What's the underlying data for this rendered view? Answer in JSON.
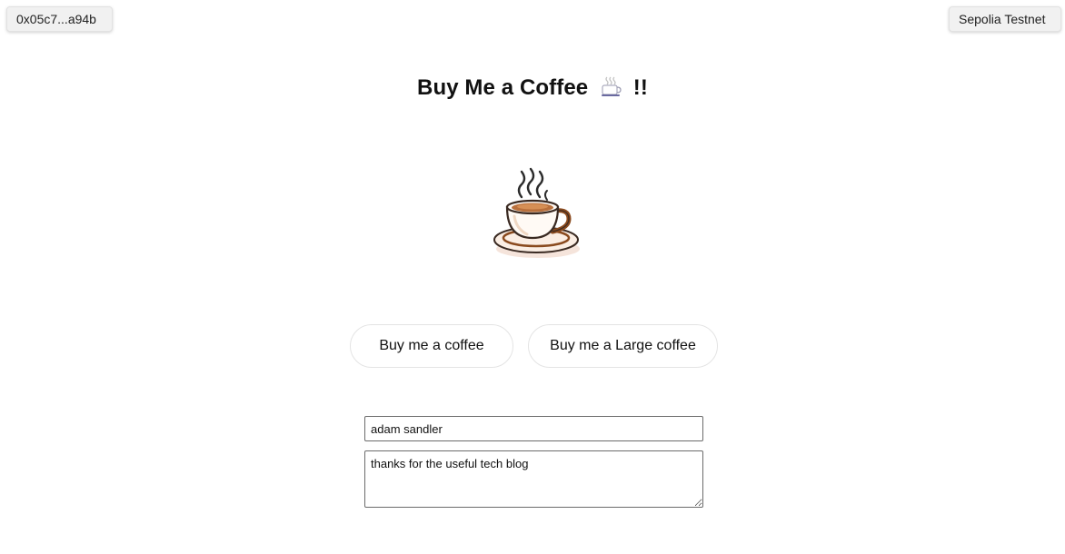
{
  "header": {
    "account_label": "0x05c7...a94b",
    "network_label": "Sepolia Testnet"
  },
  "main": {
    "title_text": "Buy Me a Coffee",
    "title_suffix": "!!",
    "title_icon": "hot-beverage-icon",
    "hero_image": "coffee-cup-icon",
    "buttons": {
      "small_label": "Buy me a coffee",
      "large_label": "Buy me a Large coffee"
    },
    "form": {
      "name_value": "adam sandler",
      "message_value": "thanks for the useful tech blog"
    }
  },
  "colors": {
    "coffee_brown": "#8a4a1e",
    "cup_outline": "#3a2a22",
    "saucer_fill": "#f6e8dc"
  }
}
